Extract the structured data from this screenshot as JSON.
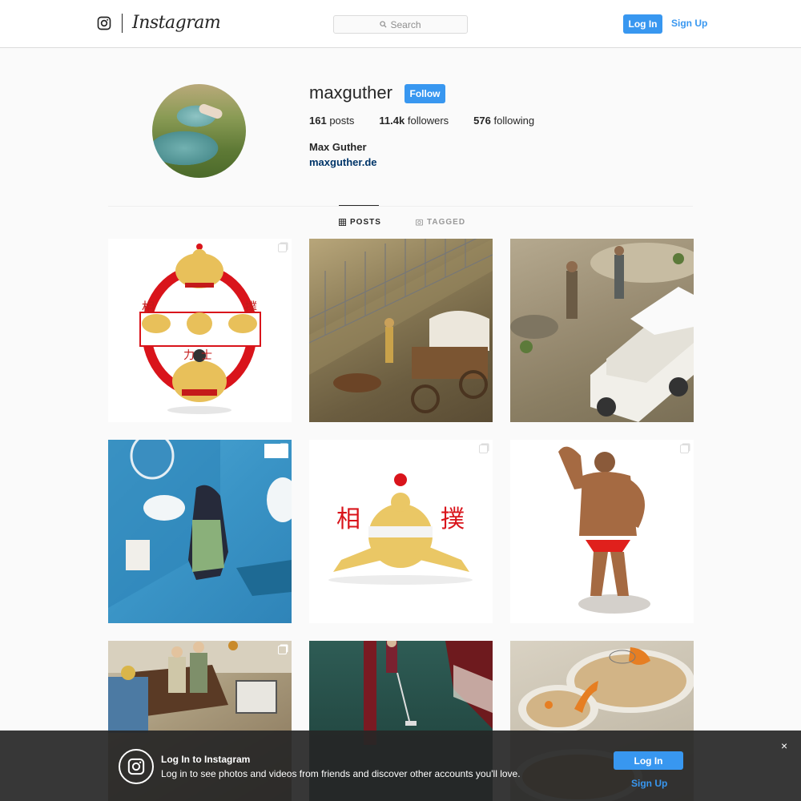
{
  "header": {
    "brand": "Instagram",
    "search_placeholder": "Search",
    "login_label": "Log In",
    "signup_label": "Sign Up"
  },
  "profile": {
    "username": "maxguther",
    "follow_label": "Follow",
    "stats": [
      {
        "count": "161",
        "label": "posts"
      },
      {
        "count": "11.4k",
        "label": "followers"
      },
      {
        "count": "576",
        "label": "following"
      }
    ],
    "full_name": "Max Guther",
    "website": "maxguther.de"
  },
  "tabs": {
    "posts": "POSTS",
    "tagged": "TAGGED",
    "active": "posts"
  },
  "posts": [
    {
      "kanji_left": "相",
      "kanji_right": "撲",
      "kanji_bottom": "力士",
      "multi": true
    },
    {
      "multi": false
    },
    {
      "multi": false
    },
    {
      "multi": true
    },
    {
      "kanji_left": "相",
      "kanji_right": "撲",
      "multi": true
    },
    {
      "multi": true
    },
    {
      "multi": true
    },
    {
      "multi": false
    },
    {
      "multi": false
    }
  ],
  "login_banner": {
    "title": "Log In to Instagram",
    "text": "Log in to see photos and videos from friends and discover other accounts you'll love.",
    "login_label": "Log In",
    "signup_label": "Sign Up",
    "close": "×"
  },
  "colors": {
    "accent": "#3897f0",
    "link_dark": "#003569",
    "border": "#dbdbdb"
  }
}
